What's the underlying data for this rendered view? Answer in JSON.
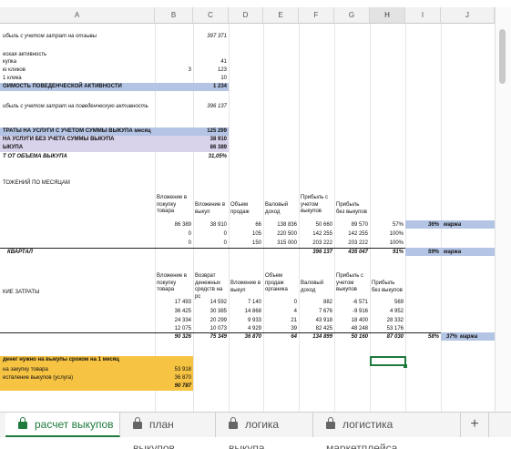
{
  "columns": [
    "A",
    "B",
    "C",
    "D",
    "E",
    "F",
    "G",
    "H",
    "I",
    "J"
  ],
  "colors": {
    "blue_band": "#b4c4e4",
    "lavender_band": "#d8d2ea",
    "orange_band": "#f6c343",
    "accent_green": "#1f7a3d"
  },
  "rows": {
    "profit_reviews": "ибыль с учетом затрат на отзывы",
    "profit_reviews_val": "397 371",
    "behavioral": "еская активность",
    "pokupka": "купка",
    "pokupka_val": "41",
    "clicks": "ю кликов",
    "clicks_b": "3",
    "clicks_c": "123",
    "one_click": "1 клика",
    "one_click_val": "10",
    "cost_behavior": "ОИМОСТЬ ПОВЕДЕНЧЕСКОЙ АКТИВНОСТИ",
    "cost_behavior_val": "1 234",
    "profit_behavior": "ибыль с учетом затрат на поведенческую активность",
    "profit_behavior_val": "396 137",
    "costs_incl": "ТРАТЫ НА УСЛУГИ С УЧЕТОМ СУММЫ ВЫКУПА месяц",
    "costs_incl_val": "125 299",
    "costs_excl": "НА УСЛУГИ БЕЗ УЧЕТА СУММЫ ВЫКУПА",
    "costs_excl_val": "38 910",
    "vykupa": "ЫКУПА",
    "vykupa_val": "86 389",
    "ot_obema": "Т ОТ ОБЪЕМА ВЫКУПА",
    "ot_obema_val": "31,05%",
    "monthly": "ТОЖЕНИЙ ПО МЕСЯЦАМ"
  },
  "table1": {
    "headers": [
      "Вложение в покупку товара",
      "Вложение в выкуп",
      "Объем продаж",
      "Валовый доход",
      "Прибыль с учетом выкупов",
      "Прибыль без выкупов"
    ],
    "rows": [
      [
        "86 389",
        "38 910",
        "66",
        "138 836",
        "50 660",
        "89 570",
        "57%"
      ],
      [
        "0",
        "0",
        "105",
        "220 500",
        "142 255",
        "142 255",
        "100%"
      ],
      [
        "0",
        "0",
        "150",
        "315 000",
        "203 222",
        "203 222",
        "100%"
      ]
    ],
    "total": [
      "396 137",
      "435 047",
      "91%"
    ],
    "total_label": "КВАРТАЛ",
    "marzha1_pct": "36%",
    "marzha1_label": "маржа",
    "marzha2_pct": "59%",
    "marzha2_label": "маржа"
  },
  "table2": {
    "label": "КИЕ ЗАТРАТЫ",
    "headers": [
      "Вложение в покупку товара",
      "Возврат денежных средств на рс",
      "Вложение в выкуп",
      "Объем продаж органика",
      "Валовый доход",
      "Прибыль с учетом выкупов",
      "Прибыль без выкупов"
    ],
    "rows": [
      [
        "17 493",
        "14 592",
        "7 140",
        "0",
        "882",
        "-6 571",
        "569"
      ],
      [
        "36 425",
        "30 385",
        "14 868",
        "4",
        "7 676",
        "-9 916",
        "4 952"
      ],
      [
        "24 334",
        "20 299",
        "9 933",
        "21",
        "43 918",
        "18 400",
        "28 332"
      ],
      [
        "12 075",
        "10 073",
        "4 929",
        "39",
        "82 425",
        "48 248",
        "53 176"
      ]
    ],
    "total": [
      "90 326",
      "75 349",
      "36 870",
      "64",
      "134 899",
      "50 160",
      "87 030",
      "58%",
      "37%",
      "маржа"
    ]
  },
  "summary": {
    "title": "денег нужно на выкупы сроком на 1 месяц",
    "r1_label": "на закупку товара",
    "r1_val": "53 918",
    "r2_label": "ествление выкупов (услуга)",
    "r2_val": "36 870",
    "total": "90 787"
  },
  "tabs": {
    "tab1": "расчет выкупов",
    "tab2": "план выкупов",
    "tab3": "логика выкупа",
    "tab4": "логистика маркетплейса",
    "add": "+"
  }
}
